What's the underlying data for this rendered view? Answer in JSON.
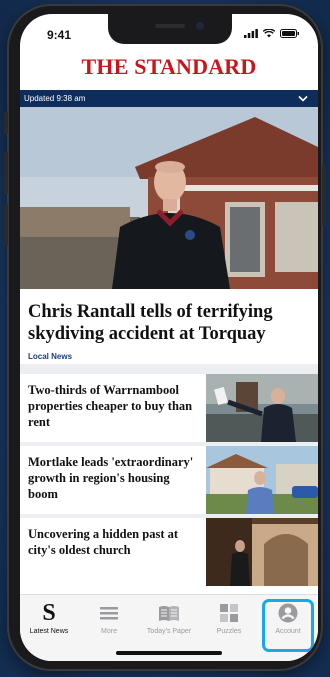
{
  "status": {
    "time": "9:41"
  },
  "masthead": {
    "title": "THE STANDARD"
  },
  "updated": {
    "text": "Updated 9:38 am"
  },
  "lead": {
    "headline": "Chris Rantall tells of terrifying skydiving accident at Torquay",
    "tag": "Local News"
  },
  "stories": [
    {
      "headline": "Two-thirds of Warrnambool properties cheaper to buy than rent"
    },
    {
      "headline": "Mortlake leads 'extraordinary' growth in region's housing boom"
    },
    {
      "headline": "Uncovering a hidden past at city's oldest church"
    }
  ],
  "tabs": [
    {
      "label": "Latest News",
      "icon": "standard-s-logo"
    },
    {
      "label": "More",
      "icon": "hamburger-icon"
    },
    {
      "label": "Today's Paper",
      "icon": "newspaper-icon"
    },
    {
      "label": "Puzzles",
      "icon": "puzzle-grid-icon"
    },
    {
      "label": "Account",
      "icon": "account-icon"
    }
  ],
  "colors": {
    "brand_red": "#c8161d",
    "navy": "#0e2d5c",
    "highlight": "#17a8ea"
  }
}
